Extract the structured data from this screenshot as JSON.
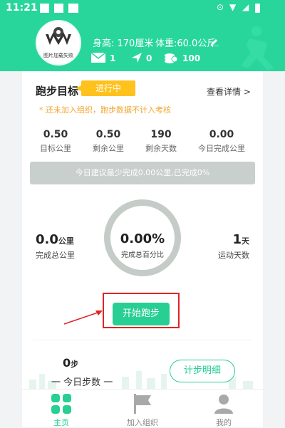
{
  "status": {
    "time": "11:21"
  },
  "header": {
    "avatar_caption": "图片加载失败",
    "height": "身高: 170厘米",
    "weight": "体重:60.0公斤",
    "mail_count": "1",
    "send_count": "0",
    "coin_count": "100"
  },
  "goal": {
    "title": "跑步目标",
    "badge": "进行中",
    "details_link": "查看详情 >",
    "warning": "* 还未加入组织，跑步数据不计入考核",
    "stats": [
      {
        "value": "0.50",
        "label": "目标公里"
      },
      {
        "value": "0.50",
        "label": "剩余公里"
      },
      {
        "value": "190",
        "label": "剩余天数"
      },
      {
        "value": "0.00",
        "label": "今日完成公里"
      }
    ],
    "suggestion": "今日建议最少完成0.00公里,已完成0%"
  },
  "progress": {
    "total_km": "0.0",
    "total_km_unit": "公里",
    "total_km_label": "完成总公里",
    "percent": "0.00%",
    "percent_label": "完成总百分比",
    "days": "1",
    "days_unit": "天",
    "days_label": "运动天数"
  },
  "start_button": "开始跑步",
  "steps": {
    "value": "0",
    "unit": "步",
    "label": "一 今日步数 一",
    "detail_button": "计步明细"
  },
  "tabs": [
    {
      "label": "主页",
      "active": true
    },
    {
      "label": "加入组织",
      "active": false
    },
    {
      "label": "我的",
      "active": false
    }
  ],
  "colors": {
    "accent": "#27cf93",
    "badge": "#ffc21c",
    "warning": "#f3a630",
    "highlight": "#e02424"
  }
}
